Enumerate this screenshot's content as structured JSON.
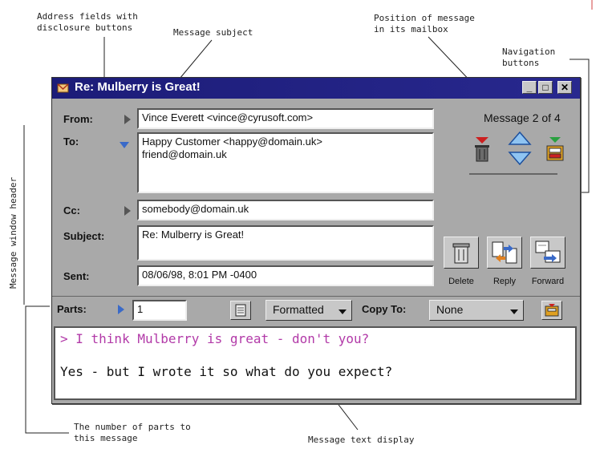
{
  "annotations": {
    "address_fields": "Address fields with\ndisclosure buttons",
    "message_subject": "Message subject",
    "position": "Position of message\nin its mailbox",
    "navigation": "Navigation\nbuttons",
    "window_header": "Message window header",
    "parts": "The number of parts to\nthis message",
    "text_display": "Message text display"
  },
  "window": {
    "title": "Re: Mulberry is Great!",
    "buttons": {
      "minimize": "_",
      "maximize": "□",
      "close": "✕"
    }
  },
  "header": {
    "from_label": "From:",
    "from_value": "Vince Everett <vince@cyrusoft.com>",
    "to_label": "To:",
    "to_line1": "Happy Customer <happy@domain.uk>",
    "to_line2": "friend@domain.uk",
    "cc_label": "Cc:",
    "cc_value": "somebody@domain.uk",
    "subject_label": "Subject:",
    "subject_value": "Re: Mulberry is Great!",
    "sent_label": "Sent:",
    "sent_value": "08/06/98, 8:01 PM -0400"
  },
  "counter": "Message 2 of 4",
  "actions": {
    "delete": "Delete",
    "reply": "Reply",
    "forward": "Forward"
  },
  "parts_bar": {
    "parts_label": "Parts:",
    "parts_value": "1",
    "format_selected": "Formatted",
    "copy_to_label": "Copy To:",
    "copy_to_selected": "None"
  },
  "body": {
    "quote_line": "> I think Mulberry is great - don't you?",
    "reply_line": "Yes - but I wrote it so what do you expect?"
  },
  "colors": {
    "title_bar": "#1c1c78",
    "quote": "#b23aa8",
    "nav_arrow": "#3a6ac8"
  }
}
